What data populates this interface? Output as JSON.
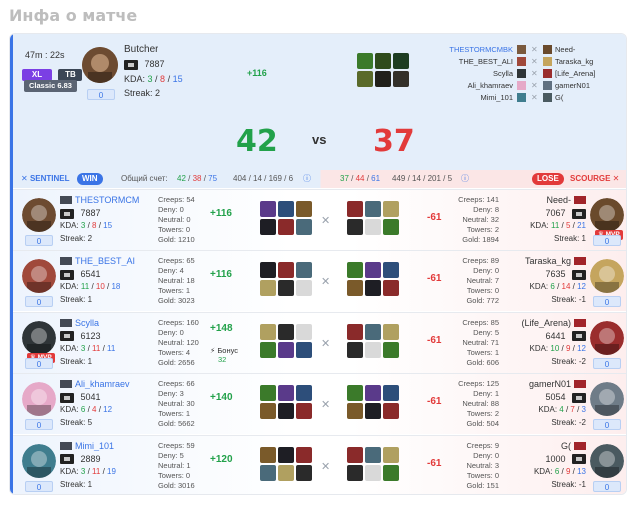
{
  "page_title": "Инфа о матче",
  "header": {
    "duration": "47m : 22s",
    "mode_xl": "XL",
    "mode_tb": "TB",
    "version": "Classic 6.83",
    "best_player": {
      "name": "Butcher",
      "rating": "7887",
      "kda_k": "3",
      "kda_d": "8",
      "kda_a": "15",
      "streak_label": "Streak: 2",
      "delta": "+116",
      "pill": "0"
    },
    "score_left": "42",
    "vs": "vs",
    "score_right": "37",
    "sentinel_list": [
      "THESTORMCMBK",
      "THE_BEST_ALI",
      "Scylla",
      "Ali_khamraev",
      "Mimi_101"
    ],
    "scourge_list": [
      "Need-",
      "Taraska_kg",
      "[Life_Arena]",
      "gamerN01",
      "G("
    ]
  },
  "stats_bar": {
    "sentinel": "SENTINEL",
    "win": "WIN",
    "total_label": "Общий счет:",
    "s_kills": "42",
    "s_deaths": "38",
    "s_assists": "75",
    "s_rest": "404 / 14 / 169 / 6",
    "c_kills": "37",
    "c_deaths": "44",
    "c_assists": "61",
    "c_rest": "449 / 14 / 201 / 5",
    "lose": "LOSE",
    "scourge": "SCOURGE"
  },
  "rows": [
    {
      "l_name": "THESTORMCM",
      "l_rating": "7887",
      "l_k": "3",
      "l_d": "8",
      "l_a": "15",
      "l_streak": "Streak: 2",
      "l_pill": "0",
      "l_stats": "Creeps: 54\nDeny: 0\nNeutral: 0\nTowers: 0\nGold: 1210",
      "l_delta": "+116",
      "r_delta": "-61",
      "r_stats": "Creeps: 141\nDeny: 8\nNeutral: 32\nTowers: 2\nGold: 1894",
      "r_name": "Need-",
      "r_rating": "7067",
      "r_k": "11",
      "r_d": "5",
      "r_a": "21",
      "r_streak": "Streak: 1",
      "r_pill": "0",
      "r_mvp": "MVP"
    },
    {
      "l_name": "THE_BEST_AI",
      "l_rating": "6541",
      "l_k": "11",
      "l_d": "10",
      "l_a": "18",
      "l_streak": "Streak: 1",
      "l_pill": "0",
      "l_stats": "Creeps: 65\nDeny: 4\nNeutral: 18\nTowers: 1\nGold: 3023",
      "l_delta": "+116",
      "r_delta": "-61",
      "r_stats": "Creeps: 89\nDeny: 0\nNeutral: 7\nTowers: 0\nGold: 772",
      "r_name": "Taraska_kg",
      "r_rating": "7635",
      "r_k": "6",
      "r_d": "14",
      "r_a": "12",
      "r_streak": "Streak: -1",
      "r_pill": "0"
    },
    {
      "l_name": "Scylla",
      "l_rating": "6123",
      "l_k": "3",
      "l_d": "11",
      "l_a": "11",
      "l_streak": "Streak: 1",
      "l_pill": "0",
      "l_mvp": "MVP",
      "l_stats": "Creeps: 160\nDeny: 0\nNeutral: 120\nTowers: 4\nGold: 2656",
      "l_delta": "+148",
      "bonus_label": "Бонус",
      "bonus_value": "32",
      "r_delta": "-61",
      "r_stats": "Creeps: 85\nDeny: 5\nNeutral: 71\nTowers: 1\nGold: 606",
      "r_name": "(Life_Arena)",
      "r_rating": "6441",
      "r_k": "10",
      "r_d": "9",
      "r_a": "12",
      "r_streak": "Streak: -2",
      "r_pill": "0"
    },
    {
      "l_name": "Ali_khamraev",
      "l_rating": "5041",
      "l_k": "6",
      "l_d": "4",
      "l_a": "12",
      "l_streak": "Streak: 5",
      "l_pill": "0",
      "l_stats": "Creeps: 66\nDeny: 3\nNeutral: 30\nTowers: 1\nGold: 5662",
      "l_delta": "+140",
      "r_delta": "-61",
      "r_stats": "Creeps: 125\nDeny: 1\nNeutral: 88\nTowers: 2\nGold: 504",
      "r_name": "gamerN01",
      "r_rating": "5054",
      "r_k": "4",
      "r_d": "7",
      "r_a": "3",
      "r_streak": "Streak: -2",
      "r_pill": "0"
    },
    {
      "l_name": "Mimi_101",
      "l_rating": "2889",
      "l_k": "3",
      "l_d": "11",
      "l_a": "19",
      "l_streak": "Streak: 1",
      "l_pill": "0",
      "l_stats": "Creeps: 59\nDeny: 5\nNeutral: 1\nTowers: 0\nGold: 3016",
      "l_delta": "+120",
      "r_delta": "-61",
      "r_stats": "Creeps: 9\nDeny: 0\nNeutral: 3\nTowers: 0\nGold: 151",
      "r_name": "G(",
      "r_rating": "1000",
      "r_k": "6",
      "r_d": "9",
      "r_a": "13",
      "r_streak": "Streak: -1",
      "r_pill": "0"
    }
  ],
  "colors": {
    "accent": "#3a74e6",
    "win": "#22a14a",
    "lose": "#e23a3a",
    "purple": "#7b3fe4"
  }
}
